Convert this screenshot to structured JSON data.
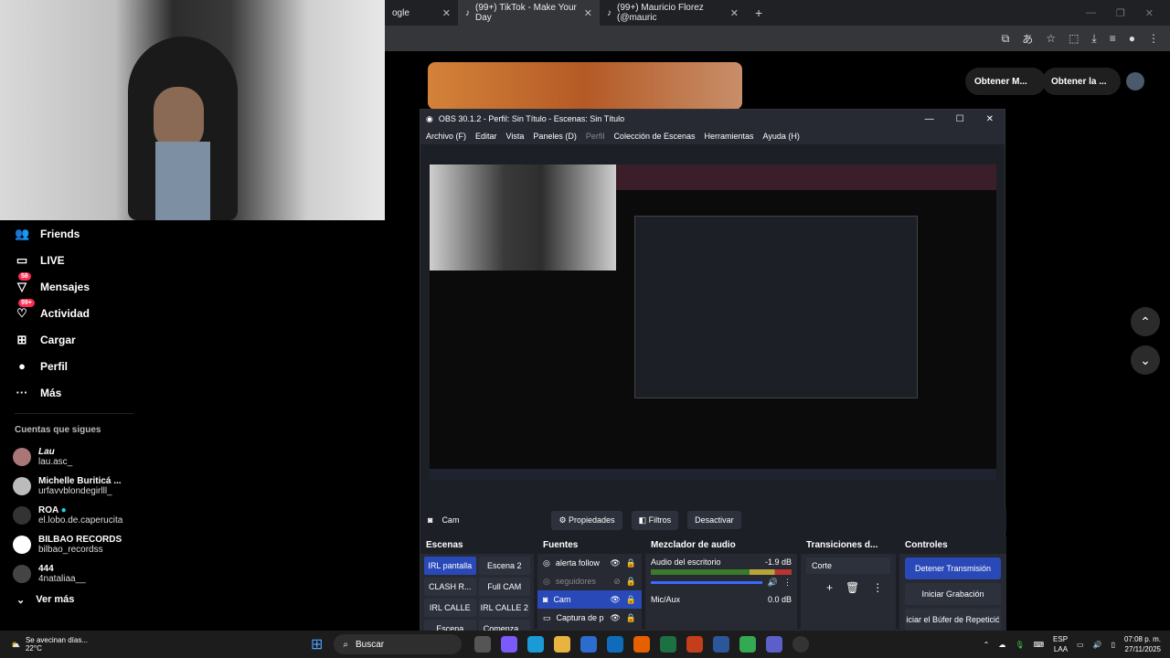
{
  "browser": {
    "tabs": [
      {
        "label": "ogle",
        "active": false
      },
      {
        "label": "(99+) TikTok - Make Your Day",
        "active": true
      },
      {
        "label": "(99+) Mauricio Florez (@mauric",
        "active": false
      }
    ],
    "new_tab": "+"
  },
  "tiktok": {
    "nav": [
      {
        "label": "Friends",
        "icon": "friends-icon"
      },
      {
        "label": "LIVE",
        "icon": "live-icon"
      },
      {
        "label": "Mensajes",
        "icon": "messages-icon",
        "badge": "58"
      },
      {
        "label": "Actividad",
        "icon": "activity-icon",
        "badge": "99+"
      },
      {
        "label": "Cargar",
        "icon": "upload-icon"
      },
      {
        "label": "Perfil",
        "icon": "profile-icon"
      },
      {
        "label": "Más",
        "icon": "more-icon"
      }
    ],
    "following_title": "Cuentas que sigues",
    "following": [
      {
        "name": "Lau",
        "user": "lau.asc_"
      },
      {
        "name": "Michelle Buriticá ...",
        "user": "urfavvblondegirlll_"
      },
      {
        "name": "ROA",
        "user": "el.lobo.de.caperucita"
      },
      {
        "name": "BILBAO RECORDS",
        "user": "bilbao_recordss"
      },
      {
        "name": "444",
        "user": "4nataliaa__"
      }
    ],
    "see_more": "Ver más",
    "pill_1": "Obtener M...",
    "pill_2": "Obtener la ..."
  },
  "obs": {
    "title": "OBS 30.1.2 - Perfil: Sin Título - Escenas: Sin Título",
    "menu": [
      "Archivo (F)",
      "Editar",
      "Vista",
      "Paneles (D)",
      "Perfil",
      "Colección de Escenas",
      "Herramientas",
      "Ayuda (H)"
    ],
    "source_name": "Cam",
    "ctx_buttons": {
      "props": "Propiedades",
      "filters": "Filtros",
      "deactivate": "Desactivar"
    },
    "docks": {
      "scenes": "Escenas",
      "sources": "Fuentes",
      "mixer": "Mezclador de audio",
      "transitions": "Transiciones d...",
      "controls": "Controles"
    },
    "scenes": [
      "IRL pantalla",
      "Escena 2",
      "CLASH R...",
      "Full CAM",
      "IRL CALLE",
      "IRL CALLE 2",
      "Escena",
      "Comenza..."
    ],
    "sources": [
      {
        "label": "alerta follow",
        "dim": false
      },
      {
        "label": "seguidores",
        "dim": true
      },
      {
        "label": "Cam",
        "dim": false
      },
      {
        "label": "Captura de p",
        "dim": false
      }
    ],
    "mixer": [
      {
        "label": "Audio del escritorio",
        "db": "-1.9 dB"
      },
      {
        "label": "Mic/Aux",
        "db": "0.0 dB"
      }
    ],
    "transition": "Corte",
    "controls": [
      "Detener Transmisión",
      "Iniciar Grabación",
      "iciar el Búfer de Repeticić"
    ]
  },
  "taskbar": {
    "weather_title": "Se avecinan días...",
    "weather_temp": "22°C",
    "search": "Buscar",
    "lang": "ESP",
    "lang2": "LAA",
    "time": "07:08 p. m.",
    "date": "27/11/2025"
  }
}
